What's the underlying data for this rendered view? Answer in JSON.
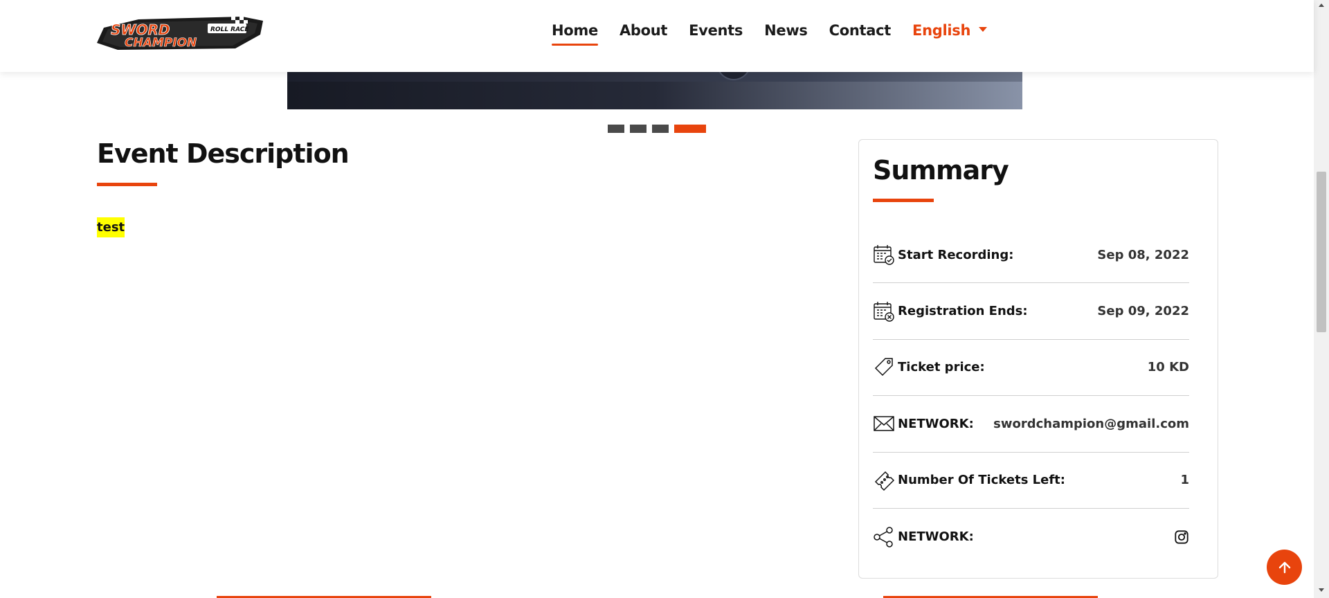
{
  "header": {
    "nav": [
      {
        "label": "Home",
        "active": true
      },
      {
        "label": "About"
      },
      {
        "label": "Events"
      },
      {
        "label": "News"
      },
      {
        "label": "Contact"
      }
    ],
    "language": "English",
    "logo_text": "SWORD CHAMPION ROLL RACE"
  },
  "carousel": {
    "slide_count": 4,
    "active_index": 3
  },
  "description": {
    "title": "Event Description",
    "text": "test"
  },
  "summary": {
    "title": "Summary",
    "rows": [
      {
        "icon": "calendar-check-icon",
        "label": "Start Recording:",
        "value": "Sep 08, 2022"
      },
      {
        "icon": "calendar-x-icon",
        "label": "Registration Ends:",
        "value": "Sep 09, 2022"
      },
      {
        "icon": "price-tag-icon",
        "label": "Ticket price:",
        "value": "10 KD"
      },
      {
        "icon": "envelope-icon",
        "label": "NETWORK:",
        "value": "swordchampion@gmail.com"
      },
      {
        "icon": "ticket-icon",
        "label": "Number Of Tickets Left:",
        "value": "1"
      },
      {
        "icon": "share-icon",
        "label": "NETWORK:",
        "value": ""
      }
    ]
  },
  "colors": {
    "accent": "#e8440d",
    "highlight": "#ffff00",
    "indicator": "#4a4a4a"
  }
}
